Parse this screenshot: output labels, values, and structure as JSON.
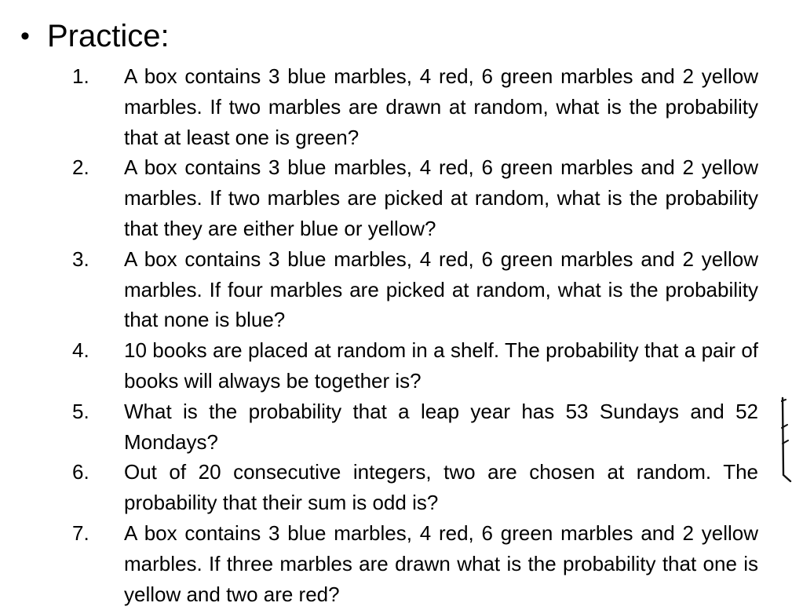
{
  "heading": {
    "bullet": "•",
    "title": "Practice:"
  },
  "problems": [
    {
      "number": "1.",
      "text": "A box contains 3 blue marbles, 4 red, 6 green marbles and 2 yellow marbles. If two marbles are drawn at random, what is the probability that at least one is green?"
    },
    {
      "number": "2.",
      "text": "A box contains 3 blue marbles, 4 red, 6 green marbles and 2 yellow marbles. If two marbles are picked at random, what is the probability that they are either blue or yellow?"
    },
    {
      "number": "3.",
      "text": "A box contains 3 blue marbles, 4 red, 6 green marbles and 2 yellow marbles. If four marbles are picked at random, what is the probability that none is blue?"
    },
    {
      "number": "4.",
      "text": "10 books are placed at random in a shelf. The probability that a pair of books will always be together is?"
    },
    {
      "number": "5.",
      "text": "What is the probability that a leap year has 53 Sundays and 52 Mondays?"
    },
    {
      "number": "6.",
      "text": "Out of 20 consecutive integers, two are chosen at random. The probability that their sum is odd is?"
    },
    {
      "number": "7.",
      "text": "A box contains 3 blue marbles, 4 red, 6 green marbles and 2 yellow marbles. If three marbles are drawn what is the probability that one is yellow and two are red?"
    }
  ]
}
